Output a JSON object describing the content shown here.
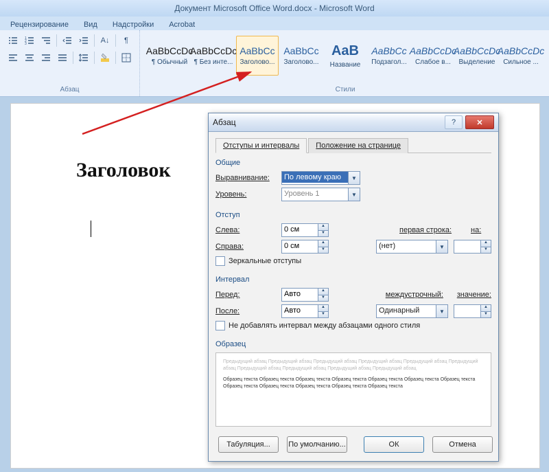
{
  "title": "Документ Microsoft Office Word.docx - Microsoft Word",
  "ribbon_tabs": [
    "Рецензирование",
    "Вид",
    "Надстройки",
    "Acrobat"
  ],
  "group_labels": {
    "paragraph": "Абзац",
    "styles": "Стили"
  },
  "styles": [
    {
      "preview": "AaBbCcDc",
      "cls": "",
      "label": "¶ Обычный"
    },
    {
      "preview": "AaBbCcDc",
      "cls": "",
      "label": "¶ Без инте..."
    },
    {
      "preview": "AaBbCc",
      "cls": "blue",
      "label": "Заголово..."
    },
    {
      "preview": "AaBbCc",
      "cls": "blue",
      "label": "Заголово..."
    },
    {
      "preview": "AaB",
      "cls": "bigblue",
      "label": "Название"
    },
    {
      "preview": "AaBbCc",
      "cls": "italic",
      "label": "Подзагол..."
    },
    {
      "preview": "AaBbCcDc",
      "cls": "italic",
      "label": "Слабое в..."
    },
    {
      "preview": "AaBbCcDc",
      "cls": "italic",
      "label": "Выделение"
    },
    {
      "preview": "AaBbCcDc",
      "cls": "italic",
      "label": "Сильное ..."
    }
  ],
  "doc": {
    "heading": "Заголовок"
  },
  "dialog": {
    "title": "Абзац",
    "tabs": {
      "active": "Отступы и интервалы",
      "other": "Положение на странице"
    },
    "general": {
      "section": "Общие",
      "align_label": "Выравнивание:",
      "align_value": "По левому краю",
      "level_label": "Уровень:",
      "level_value": "Уровень 1"
    },
    "indent": {
      "section": "Отступ",
      "left_label": "Слева:",
      "left_value": "0 см",
      "right_label": "Справа:",
      "right_value": "0 см",
      "first_label": "первая строка:",
      "first_value": "(нет)",
      "on_label": "на:",
      "on_value": "",
      "mirror": "Зеркальные отступы"
    },
    "spacing": {
      "section": "Интервал",
      "before_label": "Перед:",
      "before_value": "Авто",
      "after_label": "После:",
      "after_value": "Авто",
      "line_label": "междустрочный:",
      "line_value": "Одинарный",
      "val_label": "значение:",
      "val_value": "",
      "noadd": "Не добавлять интервал между абзацами одного стиля"
    },
    "sample": {
      "section": "Образец",
      "grey": "Предыдущий абзац Предыдущий абзац Предыдущий абзац Предыдущий абзац Предыдущий абзац Предыдущий абзац Предыдущий абзац Предыдущий абзац Предыдущий абзац Предыдущий абзац",
      "dark": "Образец текста Образец текста Образец текста Образец текста Образец текста Образец текста Образец текста Образец текста Образец текста Образец текста Образец текста Образец текста"
    },
    "buttons": {
      "tabs": "Табуляция...",
      "default": "По умолчанию...",
      "ok": "ОК",
      "cancel": "Отмена"
    }
  }
}
